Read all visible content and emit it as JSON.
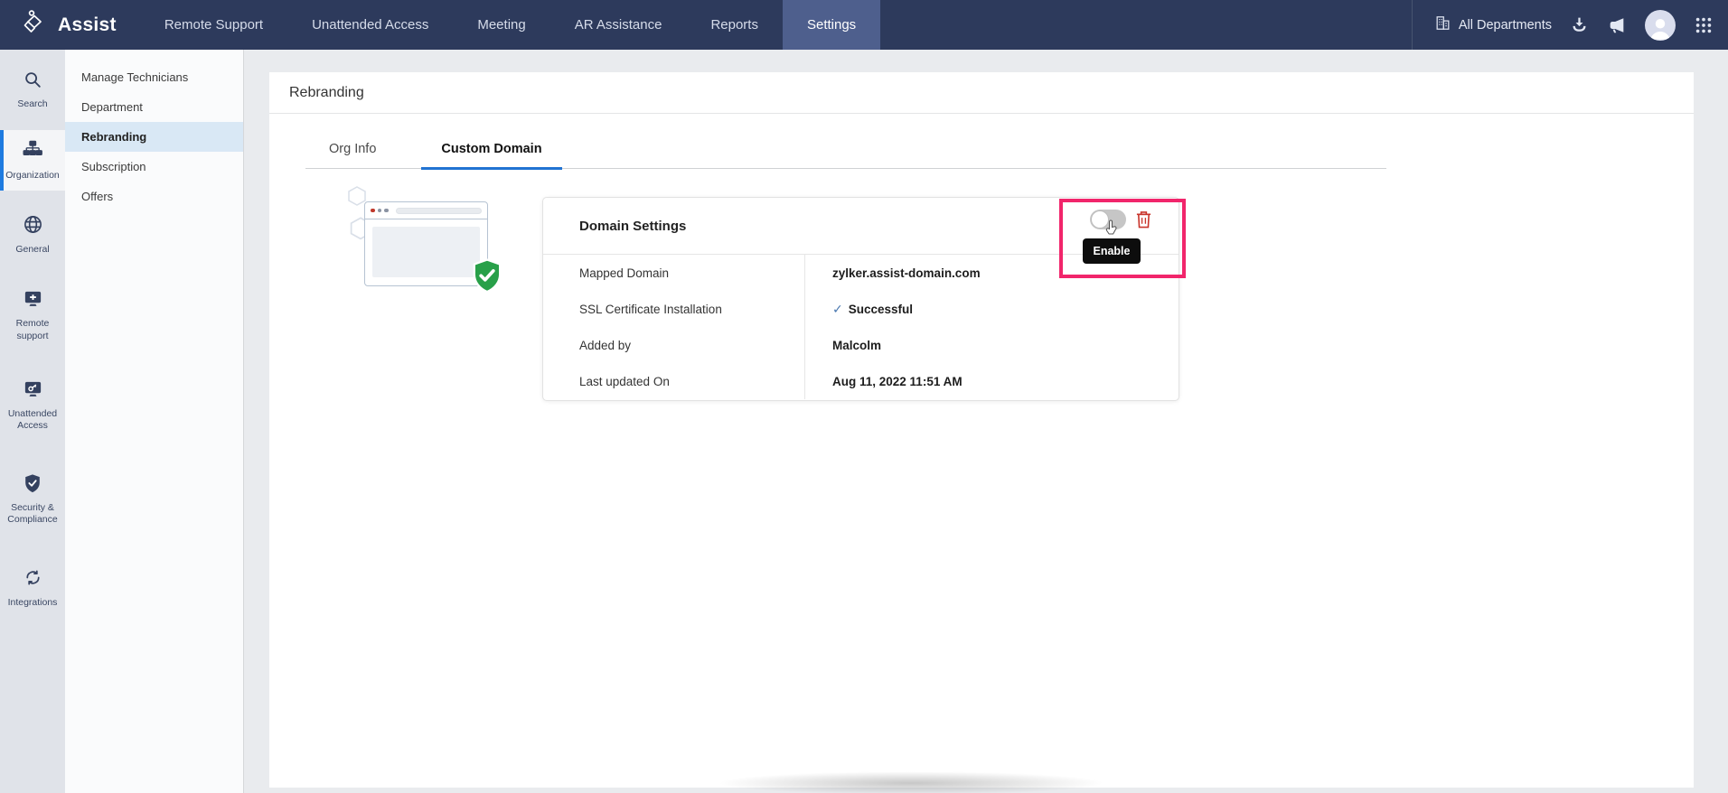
{
  "topnav": {
    "brand": "Assist",
    "items": [
      {
        "label": "Remote Support",
        "active": false
      },
      {
        "label": "Unattended Access",
        "active": false
      },
      {
        "label": "Meeting",
        "active": false
      },
      {
        "label": "AR Assistance",
        "active": false
      },
      {
        "label": "Reports",
        "active": false
      },
      {
        "label": "Settings",
        "active": true
      }
    ],
    "right": {
      "departments_label": "All Departments"
    },
    "icons": [
      "building-icon",
      "download-icon",
      "announcement-icon",
      "avatar",
      "apps-grid-icon"
    ]
  },
  "rail": {
    "items": [
      {
        "label": "Search",
        "icon": "search-icon",
        "active": false
      },
      {
        "label": "Organization",
        "icon": "org-chart-icon",
        "active": true
      },
      {
        "label": "General",
        "icon": "globe-icon",
        "active": false
      },
      {
        "label": "Remote support",
        "icon": "remote-screen-plus-icon",
        "active": false
      },
      {
        "label": "Unattended Access",
        "icon": "screen-key-icon",
        "active": false
      },
      {
        "label": "Security & Compliance",
        "icon": "shield-check-icon",
        "active": false
      },
      {
        "label": "Integrations",
        "icon": "sync-arrows-icon",
        "active": false
      }
    ]
  },
  "sidebar": {
    "items": [
      {
        "label": "Manage Technicians",
        "active": false
      },
      {
        "label": "Department",
        "active": false
      },
      {
        "label": "Rebranding",
        "active": true
      },
      {
        "label": "Subscription",
        "active": false
      },
      {
        "label": "Offers",
        "active": false
      }
    ]
  },
  "main": {
    "title": "Rebranding",
    "tabs": [
      {
        "label": "Org Info",
        "active": false
      },
      {
        "label": "Custom Domain",
        "active": true
      }
    ],
    "card": {
      "title": "Domain Settings",
      "rows": [
        {
          "label": "Mapped Domain",
          "value": "zylker.assist-domain.com"
        },
        {
          "label": "SSL Certificate Installation",
          "value": "Successful",
          "icon": "✓"
        },
        {
          "label": "Added by",
          "value": "Malcolm"
        },
        {
          "label": "Last updated On",
          "value": "Aug 11, 2022 11:51 AM"
        }
      ],
      "actions": {
        "toggle": "enable-toggle",
        "delete": "delete-domain"
      },
      "tooltip": "Enable"
    },
    "illustration": {
      "badge": "verified-shield"
    }
  },
  "colors": {
    "navbar": "#2d3a5c",
    "navbar_active": "#4e5f8d",
    "rail_active_border": "#1e7be0",
    "sidebar_active_bg": "#d9e8f5",
    "tab_underline": "#2173d2",
    "highlight_pink": "#f1256b",
    "success_green": "#28a049",
    "danger_red": "#c9352c",
    "tooltip_bg": "#0d0d0d",
    "check_blue": "#4a78b0"
  }
}
